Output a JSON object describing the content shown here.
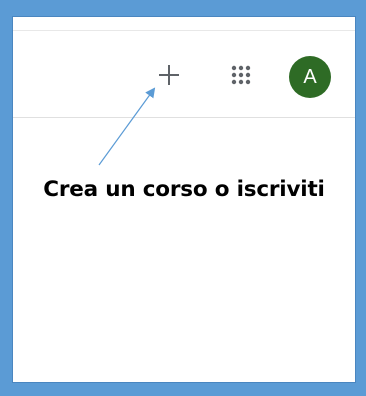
{
  "header": {
    "create_icon": "plus-icon",
    "apps_icon": "apps-grid-icon",
    "avatar_initial": "A",
    "avatar_color": "#2e6b25"
  },
  "annotation": {
    "text": "Crea un corso o iscriviti",
    "arrow_color": "#5b9bd5"
  },
  "colors": {
    "frame": "#5b9bd5",
    "icon": "#5f6368"
  }
}
